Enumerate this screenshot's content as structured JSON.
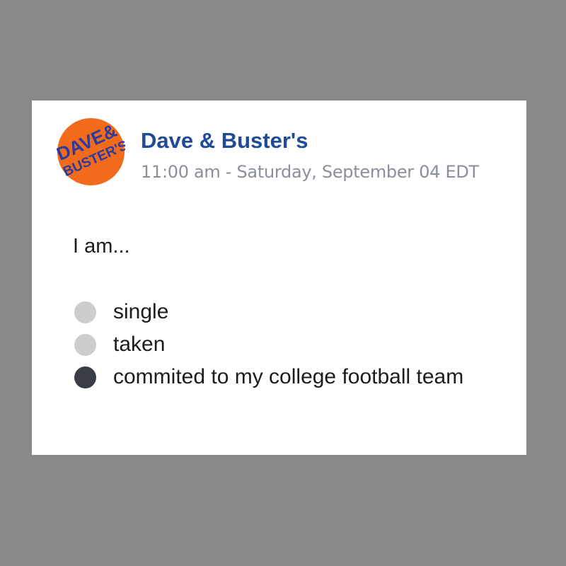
{
  "post": {
    "author": "Dave & Buster's",
    "timestamp": "11:00 am - Saturday, September 04 EDT",
    "avatar": {
      "icon": "dave-and-busters-logo",
      "logo_text_line1": "DAVE&",
      "logo_text_line2": "BUSTER'S",
      "background_color": "#f26b1d",
      "text_color": "#2a3a9e"
    },
    "question": "I am...",
    "poll": {
      "options": [
        {
          "label": "single",
          "selected": false
        },
        {
          "label": "taken",
          "selected": false
        },
        {
          "label": "commited to my college football team",
          "selected": true
        }
      ]
    }
  },
  "colors": {
    "background": "#898989",
    "card": "#ffffff",
    "author": "#1f4a96",
    "timestamp": "#8a8f99",
    "radio_unselected": "#cdcdcd",
    "radio_selected": "#383e44"
  }
}
